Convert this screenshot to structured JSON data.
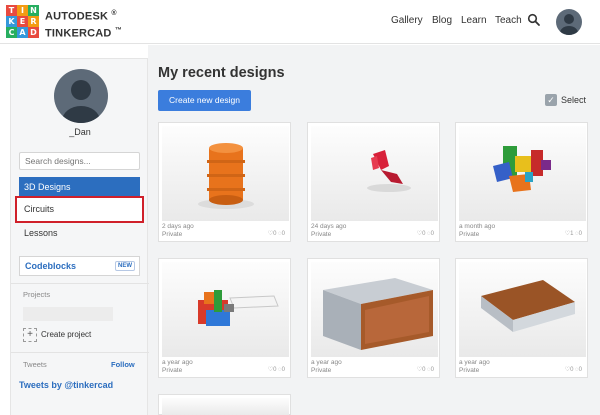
{
  "header": {
    "logo_letters": [
      "T",
      "I",
      "N",
      "K",
      "E",
      "R",
      "C",
      "A",
      "D"
    ],
    "brand_line1": "AUTODESK",
    "brand_line2": "TINKERCAD",
    "reg_mark": "®",
    "tm_mark": "™",
    "nav": [
      "Gallery",
      "Blog",
      "Learn",
      "Teach"
    ],
    "search_icon": "search-icon"
  },
  "sidebar": {
    "username": "_Dan",
    "search_placeholder": "Search designs...",
    "items": [
      {
        "label": "3D Designs"
      },
      {
        "label": "Circuits"
      },
      {
        "label": "Lessons"
      }
    ],
    "codeblocks": "Codeblocks",
    "new_badge": "NEW",
    "projects_label": "Projects",
    "create_project": "Create project",
    "tweets_label": "Tweets",
    "follow": "Follow",
    "tweets_link": "Tweets by @tinkercad"
  },
  "main": {
    "title": "My recent designs",
    "create_button": "Create new design",
    "select_label": "Select",
    "cards": [
      {
        "date": "2 days ago",
        "privacy": "Private",
        "likes": "0",
        "comments": "0"
      },
      {
        "date": "24 days ago",
        "privacy": "Private",
        "likes": "0",
        "comments": "0"
      },
      {
        "date": "a month ago",
        "privacy": "Private",
        "likes": "1",
        "comments": "0"
      },
      {
        "date": "a year ago",
        "privacy": "Private",
        "likes": "0",
        "comments": "0"
      },
      {
        "date": "a year ago",
        "privacy": "Private",
        "likes": "0",
        "comments": "0"
      },
      {
        "date": "a year ago",
        "privacy": "Private",
        "likes": "0",
        "comments": "0"
      }
    ]
  },
  "colors": {
    "accent": "#2c6ebf",
    "button": "#3b7ddd",
    "highlight": "#d0202a",
    "logo": [
      "#e84a3f",
      "#f39c12",
      "#27ae60",
      "#3498db",
      "#e84a3f",
      "#f39c12",
      "#27ae60",
      "#3498db",
      "#e84a3f"
    ]
  }
}
